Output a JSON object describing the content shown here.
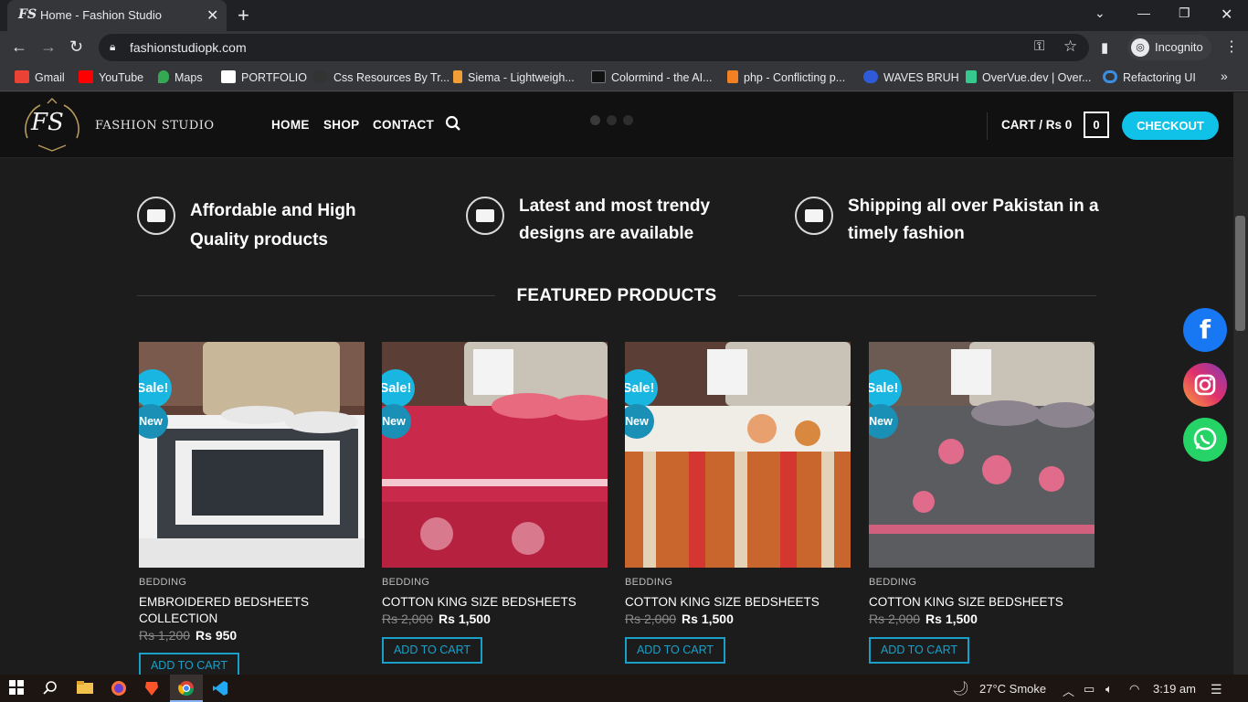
{
  "browser": {
    "tab_title": "Home - Fashion Studio",
    "tab_favicon": "FS",
    "url": "fashionstudiopk.com",
    "incognito_label": "Incognito",
    "bookmarks": [
      {
        "label": "Gmail",
        "color": "#ea4335"
      },
      {
        "label": "YouTube",
        "color": "#ff0000"
      },
      {
        "label": "Maps",
        "color": "#34a853"
      },
      {
        "label": "PORTFOLIO",
        "color": "#ffffff"
      },
      {
        "label": "Css Resources By Tr...",
        "color": "#333333"
      },
      {
        "label": "Siema - Lightweigh...",
        "color": "#f29e36"
      },
      {
        "label": "Colormind - the AI...",
        "color": "#111111"
      },
      {
        "label": "php - Conflicting p...",
        "color": "#f48024"
      },
      {
        "label": "WAVES BRUH",
        "color": "#2f5bd8"
      },
      {
        "label": "OverVue.dev | Over...",
        "color": "#35c98f"
      },
      {
        "label": "Refactoring UI",
        "color": "#3a8fe0"
      }
    ]
  },
  "header": {
    "logo_mark": "FS",
    "logo_text": "FASHION STUDIO",
    "nav": [
      "HOME",
      "SHOP",
      "CONTACT"
    ],
    "cart_label": "CART / Rs 0",
    "cart_count": "0",
    "checkout_label": "CHECKOUT"
  },
  "features": [
    "Affordable and High Quality products",
    "Latest and most trendy designs are available",
    "Shipping all over Pakistan in a timely fashion"
  ],
  "section_title": "FEATURED PRODUCTS",
  "badges": {
    "sale": "Sale!",
    "new": "New"
  },
  "products": [
    {
      "category": "BEDDING",
      "name": "EMBROIDERED BEDSHEETS COLLECTION",
      "old_price": "Rs 1,200",
      "price": "Rs 950",
      "button": "ADD TO CART"
    },
    {
      "category": "BEDDING",
      "name": "COTTON KING SIZE BEDSHEETS",
      "old_price": "Rs 2,000",
      "price": "Rs 1,500",
      "button": "ADD TO CART"
    },
    {
      "category": "BEDDING",
      "name": "COTTON KING SIZE BEDSHEETS",
      "old_price": "Rs 2,000",
      "price": "Rs 1,500",
      "button": "ADD TO CART"
    },
    {
      "category": "BEDDING",
      "name": "COTTON KING SIZE BEDSHEETS",
      "old_price": "Rs 2,000",
      "price": "Rs 1,500",
      "button": "ADD TO CART"
    }
  ],
  "social": {
    "facebook": "f",
    "facebook_color": "#1877f2",
    "whatsapp_color": "#25d366"
  },
  "taskbar": {
    "weather": "27°C Smoke",
    "time": "3:19 am"
  },
  "colors": {
    "accent": "#11c2e8",
    "background": "#1c1c1c"
  }
}
